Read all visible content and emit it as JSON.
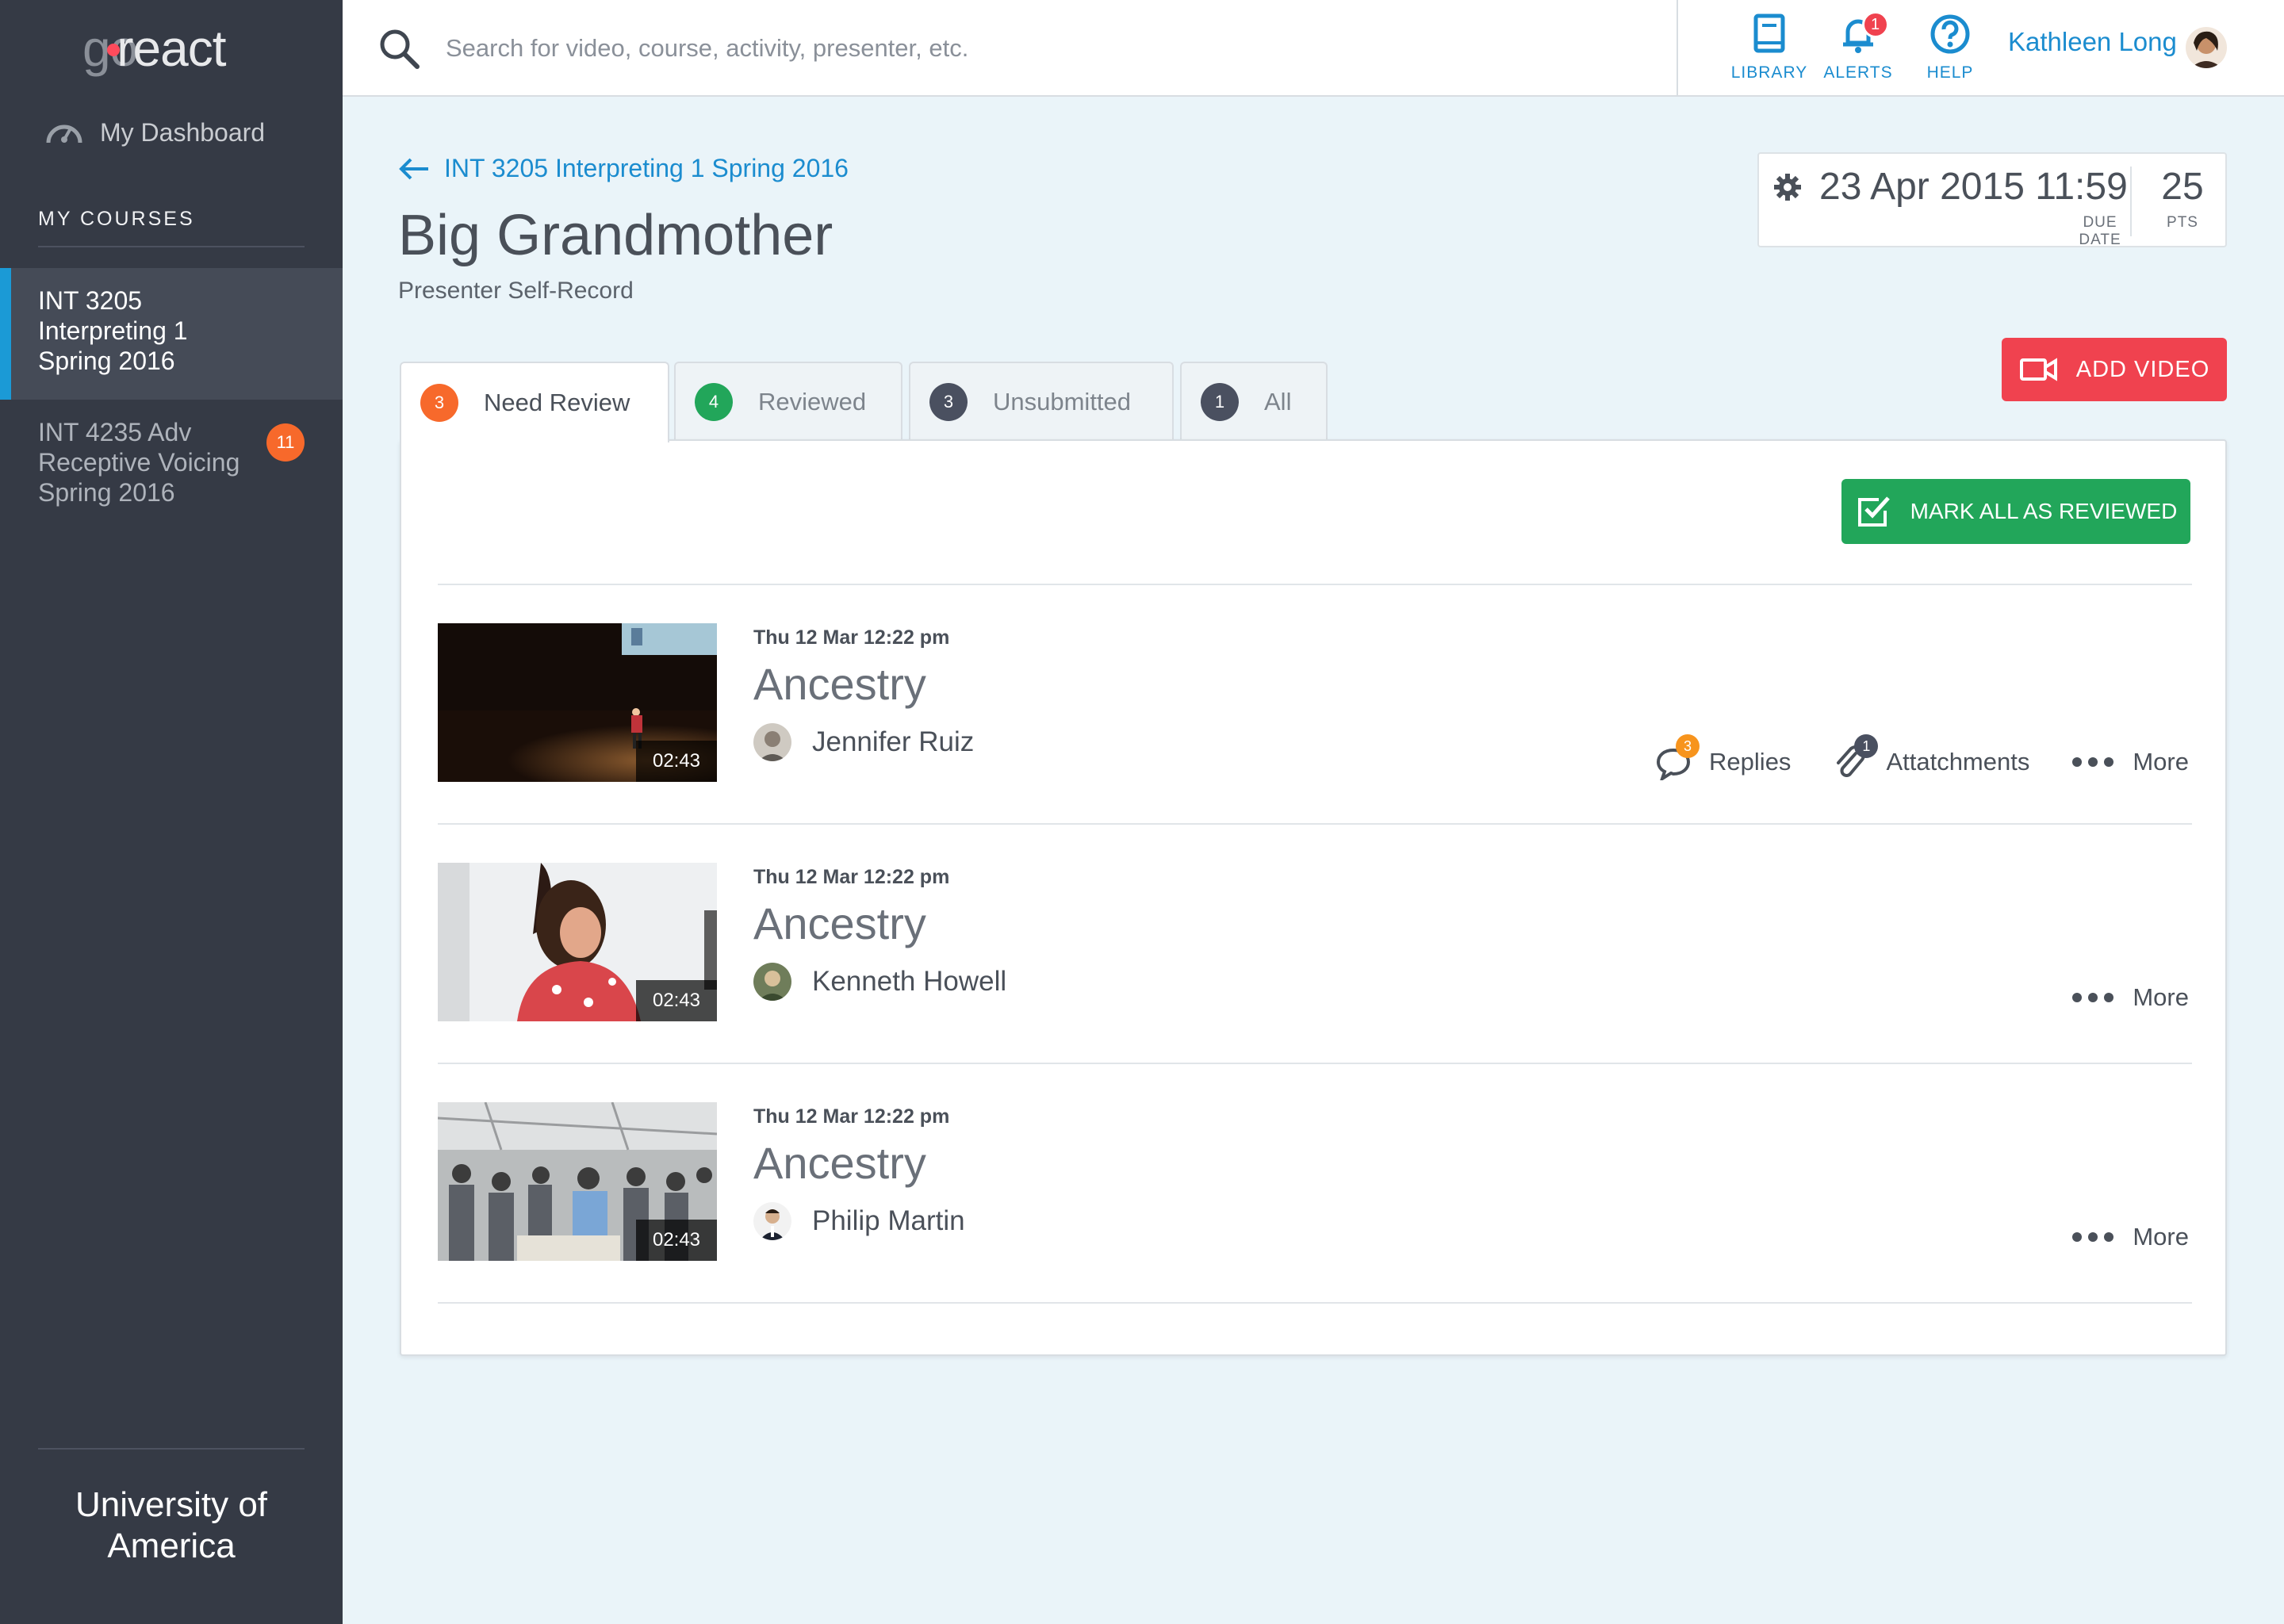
{
  "app": {
    "logo_go": "go",
    "logo_react": "react"
  },
  "sidebar": {
    "dashboard_label": "My Dashboard",
    "courses_heading": "MY COURSES",
    "courses": [
      {
        "label": "INT 3205 Interpreting 1 Spring 2016",
        "active": true
      },
      {
        "label": "INT 4235 Adv Receptive Voicing Spring 2016",
        "badge": "11"
      }
    ],
    "footer": "University of America"
  },
  "topbar": {
    "search_placeholder": "Search for video, course, activity, presenter, etc.",
    "nav": [
      {
        "label": "LIBRARY",
        "icon": "book-icon"
      },
      {
        "label": "ALERTS",
        "icon": "bell-icon",
        "badge": "1"
      },
      {
        "label": "HELP",
        "icon": "question-icon"
      }
    ],
    "user_name": "Kathleen Long"
  },
  "header": {
    "breadcrumb": "INT 3205 Interpreting 1 Spring 2016",
    "title": "Big Grandmother",
    "subtitle": "Presenter Self-Record",
    "due_date": "23 Apr 2015 11:59",
    "due_label": "DUE DATE",
    "points": "25",
    "points_label": "PTS",
    "add_video_label": "ADD VIDEO"
  },
  "tabs": [
    {
      "count": "3",
      "label": "Need Review",
      "color": "#f7692b",
      "active": true
    },
    {
      "count": "4",
      "label": "Reviewed",
      "color": "#22a65a"
    },
    {
      "count": "3",
      "label": "Unsubmitted",
      "color": "#4a5060"
    },
    {
      "count": "1",
      "label": "All",
      "color": "#4a5060"
    }
  ],
  "panel": {
    "mark_all_label": "MARK ALL AS REVIEWED",
    "items": [
      {
        "timestamp": "Thu 12 Mar 12:22 pm",
        "name": "Ancestry",
        "presenter": "Jennifer Ruiz",
        "duration": "02:43",
        "replies_label": "Replies",
        "replies_count": "3",
        "attachments_label": "Attatchments",
        "attachments_count": "1",
        "more_label": "More"
      },
      {
        "timestamp": "Thu 12 Mar 12:22 pm",
        "name": "Ancestry",
        "presenter": "Kenneth Howell",
        "duration": "02:43",
        "more_label": "More"
      },
      {
        "timestamp": "Thu 12 Mar 12:22 pm",
        "name": "Ancestry",
        "presenter": "Philip Martin",
        "duration": "02:43",
        "more_label": "More"
      }
    ]
  },
  "colors": {
    "sidebar_bg": "#353a45",
    "accent_blue": "#1b8ccf",
    "add_red": "#f0424f",
    "review_green": "#22a65a",
    "badge_orange": "#f7692b"
  }
}
